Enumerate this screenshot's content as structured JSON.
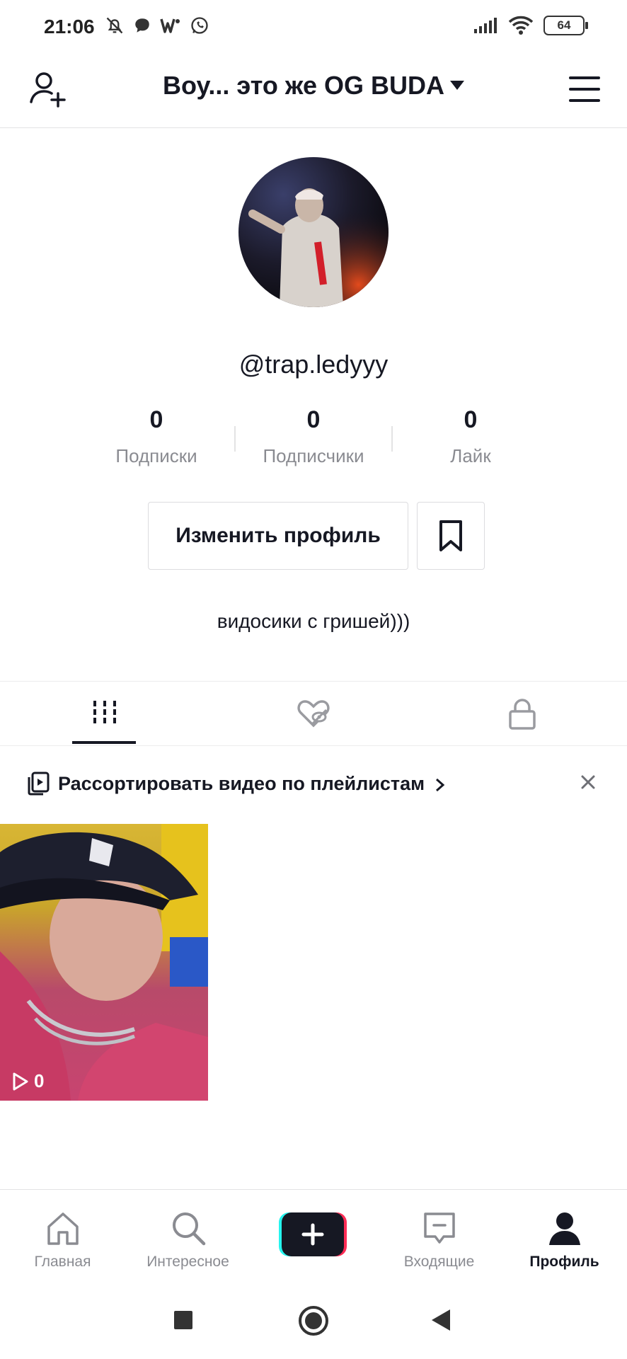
{
  "status_bar": {
    "time": "21:06",
    "battery": "64",
    "left_icons": [
      "bell-off-icon",
      "message-bubble-icon",
      "w-app-icon",
      "whatsapp-icon"
    ],
    "right_icons": [
      "signal-icon",
      "wifi-icon",
      "battery-icon"
    ]
  },
  "header": {
    "title": "Воу... это же OG BUDA",
    "left_icon": "add-user-icon",
    "right_icon": "menu-icon"
  },
  "profile": {
    "username": "@trap.ledyyy",
    "bio": "видосики с гришей)))",
    "stats": [
      {
        "value": "0",
        "label": "Подписки"
      },
      {
        "value": "0",
        "label": "Подписчики"
      },
      {
        "value": "0",
        "label": "Лайк"
      }
    ],
    "edit_button": "Изменить профиль"
  },
  "tabs": [
    {
      "icon": "grid-icon",
      "active": true
    },
    {
      "icon": "liked-hidden-icon",
      "active": false
    },
    {
      "icon": "lock-icon",
      "active": false
    }
  ],
  "playlist_banner": {
    "text": "Рассортировать видео по плейлистам"
  },
  "videos": [
    {
      "views": "0"
    }
  ],
  "bottom_nav": [
    {
      "label": "Главная",
      "icon": "home-icon",
      "active": false
    },
    {
      "label": "Интересное",
      "icon": "search-icon",
      "active": false
    },
    {
      "label": "",
      "icon": "plus-icon",
      "active": false
    },
    {
      "label": "Входящие",
      "icon": "inbox-icon",
      "active": false
    },
    {
      "label": "Профиль",
      "icon": "profile-icon",
      "active": true
    }
  ],
  "colors": {
    "text": "#161823",
    "secondary": "#8a8b91",
    "plus_left": "#25f4ee",
    "plus_right": "#fe2c55"
  }
}
